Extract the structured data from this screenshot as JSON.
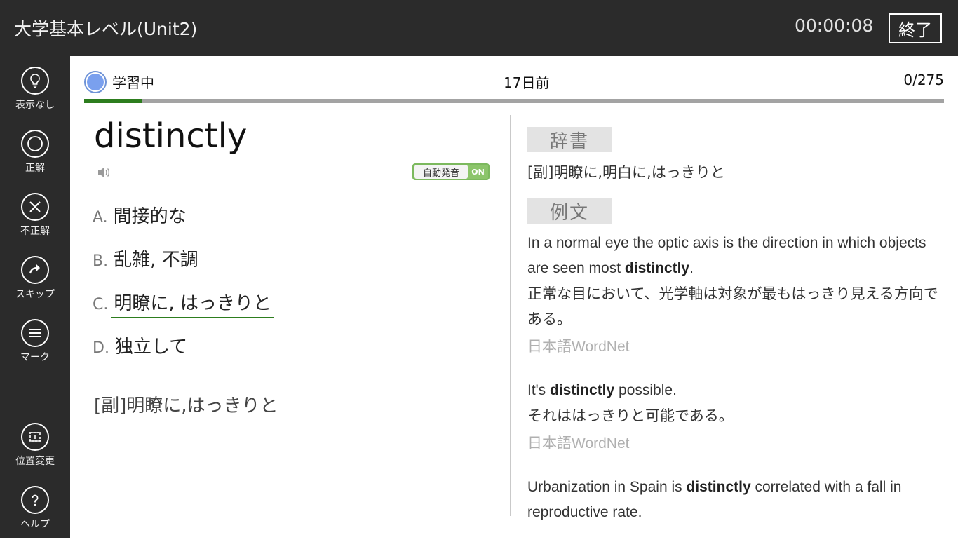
{
  "header": {
    "title": "大学基本レベル(Unit2)",
    "timer": "00:00:08",
    "end_label": "終了"
  },
  "sidebar": {
    "items": [
      {
        "label": "表示なし",
        "icon": "lightbulb-icon"
      },
      {
        "label": "正解",
        "icon": "circle-icon"
      },
      {
        "label": "不正解",
        "icon": "x-icon"
      },
      {
        "label": "スキップ",
        "icon": "arrow-right-icon"
      },
      {
        "label": "マーク",
        "icon": "menu-icon"
      },
      {
        "label": "位置変更",
        "icon": "reposition-icon"
      },
      {
        "label": "ヘルプ",
        "icon": "help-icon"
      }
    ]
  },
  "status": {
    "label": "学習中",
    "days_ago": "17日前",
    "count": "0/275",
    "progress_fraction": 0.068,
    "progress_color": "#2d7d1e"
  },
  "question": {
    "word": "distinctly",
    "auto_pronounce_label": "自動発音",
    "auto_pronounce_state": "ON",
    "choices": [
      {
        "letter": "A.",
        "text": "間接的な"
      },
      {
        "letter": "B.",
        "text": "乱雑, 不調"
      },
      {
        "letter": "C.",
        "text": "明瞭に, はっきりと"
      },
      {
        "letter": "D.",
        "text": "独立して"
      }
    ],
    "meaning": "[副]明瞭に,はっきりと"
  },
  "dictionary": {
    "label": "辞書",
    "definition": "[副]明瞭に,明白に,はっきりと"
  },
  "examples": {
    "label": "例文",
    "items": [
      {
        "en_before": "In a normal eye the optic axis is the direction in which objects are seen most ",
        "en_bold": "distinctly",
        "en_after": ".",
        "ja": "正常な目において、光学軸は対象が最もはっきり見える方向である。",
        "source": "日本語WordNet"
      },
      {
        "en_before": "It's ",
        "en_bold": "distinctly",
        "en_after": " possible.",
        "ja": "それははっきりと可能である。",
        "source": "日本語WordNet"
      },
      {
        "en_before": "Urbanization in Spain is ",
        "en_bold": "distinctly",
        "en_after": " correlated with a fall in reproductive rate."
      }
    ]
  }
}
